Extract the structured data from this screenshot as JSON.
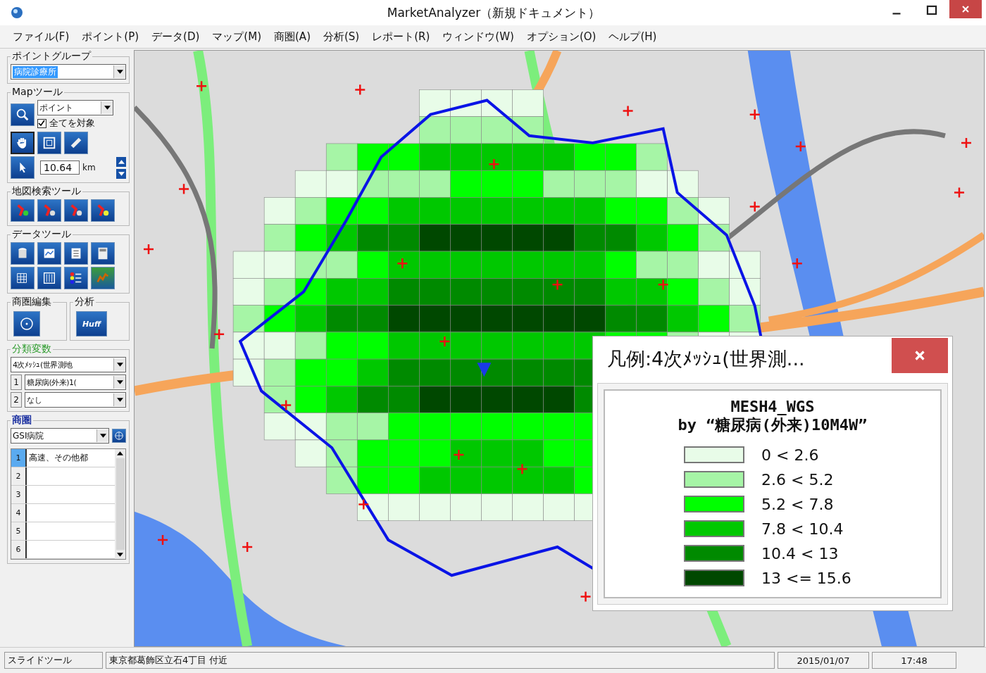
{
  "window": {
    "title": "MarketAnalyzer（新規ドキュメント）"
  },
  "menu": [
    "ファイル(F)",
    "ポイント(P)",
    "データ(D)",
    "マップ(M)",
    "商圏(A)",
    "分析(S)",
    "レポート(R)",
    "ウィンドウ(W)",
    "オプション(O)",
    "ヘルプ(H)"
  ],
  "point_group": {
    "title": "ポイントグループ",
    "value": "病院診療所"
  },
  "map_tools": {
    "title": "Mapツール",
    "mode": "ポイント",
    "all_targets": {
      "label": "全てを対象",
      "checked": true
    },
    "scale": "10.64",
    "unit": "km"
  },
  "search_tools": {
    "title": "地図検索ツール"
  },
  "data_tools": {
    "title": "データツール"
  },
  "area_edit": {
    "title": "商圏編集"
  },
  "analysis": {
    "title": "分析",
    "huff": "Huff"
  },
  "classification": {
    "title": "分類変数",
    "mesh": "4次ﾒｯｼｭ(世界測地",
    "vars": [
      {
        "index": "1",
        "value": "糖尿病(外来)1("
      },
      {
        "index": "2",
        "value": "なし"
      }
    ]
  },
  "trade_area": {
    "title": "商圏",
    "value": "GSI病院",
    "rows": [
      {
        "index": "1",
        "value": "高速、その他都",
        "selected": true
      },
      {
        "index": "2",
        "value": "",
        "selected": false
      },
      {
        "index": "3",
        "value": "",
        "selected": false
      },
      {
        "index": "4",
        "value": "",
        "selected": false
      },
      {
        "index": "5",
        "value": "",
        "selected": false
      },
      {
        "index": "6",
        "value": "",
        "selected": false
      }
    ]
  },
  "legend": {
    "title": "凡例:4次ﾒｯｼｭ(世界測...",
    "heading": "MESH4_WGS",
    "subheading": "by “糖尿病(外来)10M4W”",
    "items": [
      {
        "label": "0 < 2.6",
        "color": "#e8fce8"
      },
      {
        "label": "2.6 < 5.2",
        "color": "#a6f5a6"
      },
      {
        "label": "5.2 < 7.8",
        "color": "#00ff00"
      },
      {
        "label": "7.8 < 10.4",
        "color": "#00c800"
      },
      {
        "label": "10.4 < 13",
        "color": "#008a00"
      },
      {
        "label": "13 <= 15.6",
        "color": "#004800"
      }
    ]
  },
  "status_bar": [
    "スライドツール",
    "東京都葛飾区立石4丁目 付近",
    "2015/01/07",
    "17:48"
  ]
}
